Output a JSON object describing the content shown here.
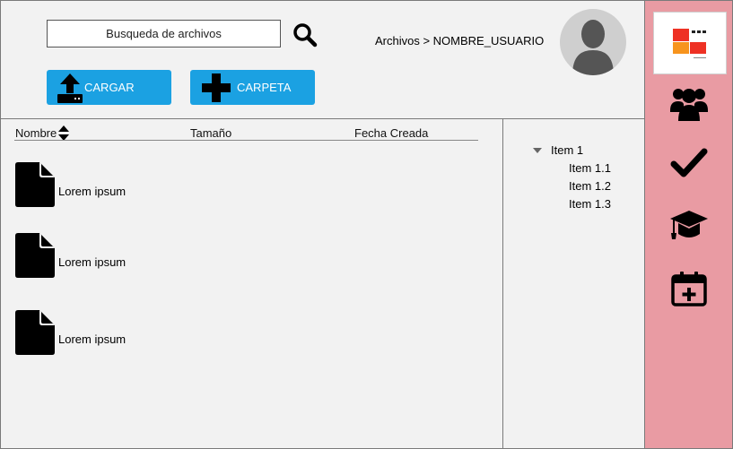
{
  "search": {
    "placeholder": "Busqueda de archivos"
  },
  "header": {
    "breadcrumb": "Archivos > NOMBRE_USUARIO"
  },
  "toolbar": {
    "upload_label": "CARGAR",
    "folder_label": "CARPETA"
  },
  "table": {
    "columns": [
      "Nombre",
      "Tamaño",
      "Fecha Creada"
    ],
    "rows": [
      {
        "name": "Lorem ipsum"
      },
      {
        "name": "Lorem ipsum"
      },
      {
        "name": "Lorem ipsum"
      }
    ]
  },
  "tree": {
    "root": "Item 1",
    "children": [
      "Item 1.1",
      "Item 1.2",
      "Item 1.3"
    ]
  },
  "sidebar": {
    "icons": [
      "users-icon",
      "check-icon",
      "graduation-cap-icon",
      "calendar-plus-icon"
    ]
  },
  "colors": {
    "accent": "#1ba1e2",
    "sidebar": "#e99ba3",
    "logo_red": "#ee3124",
    "logo_orange": "#f7941d"
  }
}
